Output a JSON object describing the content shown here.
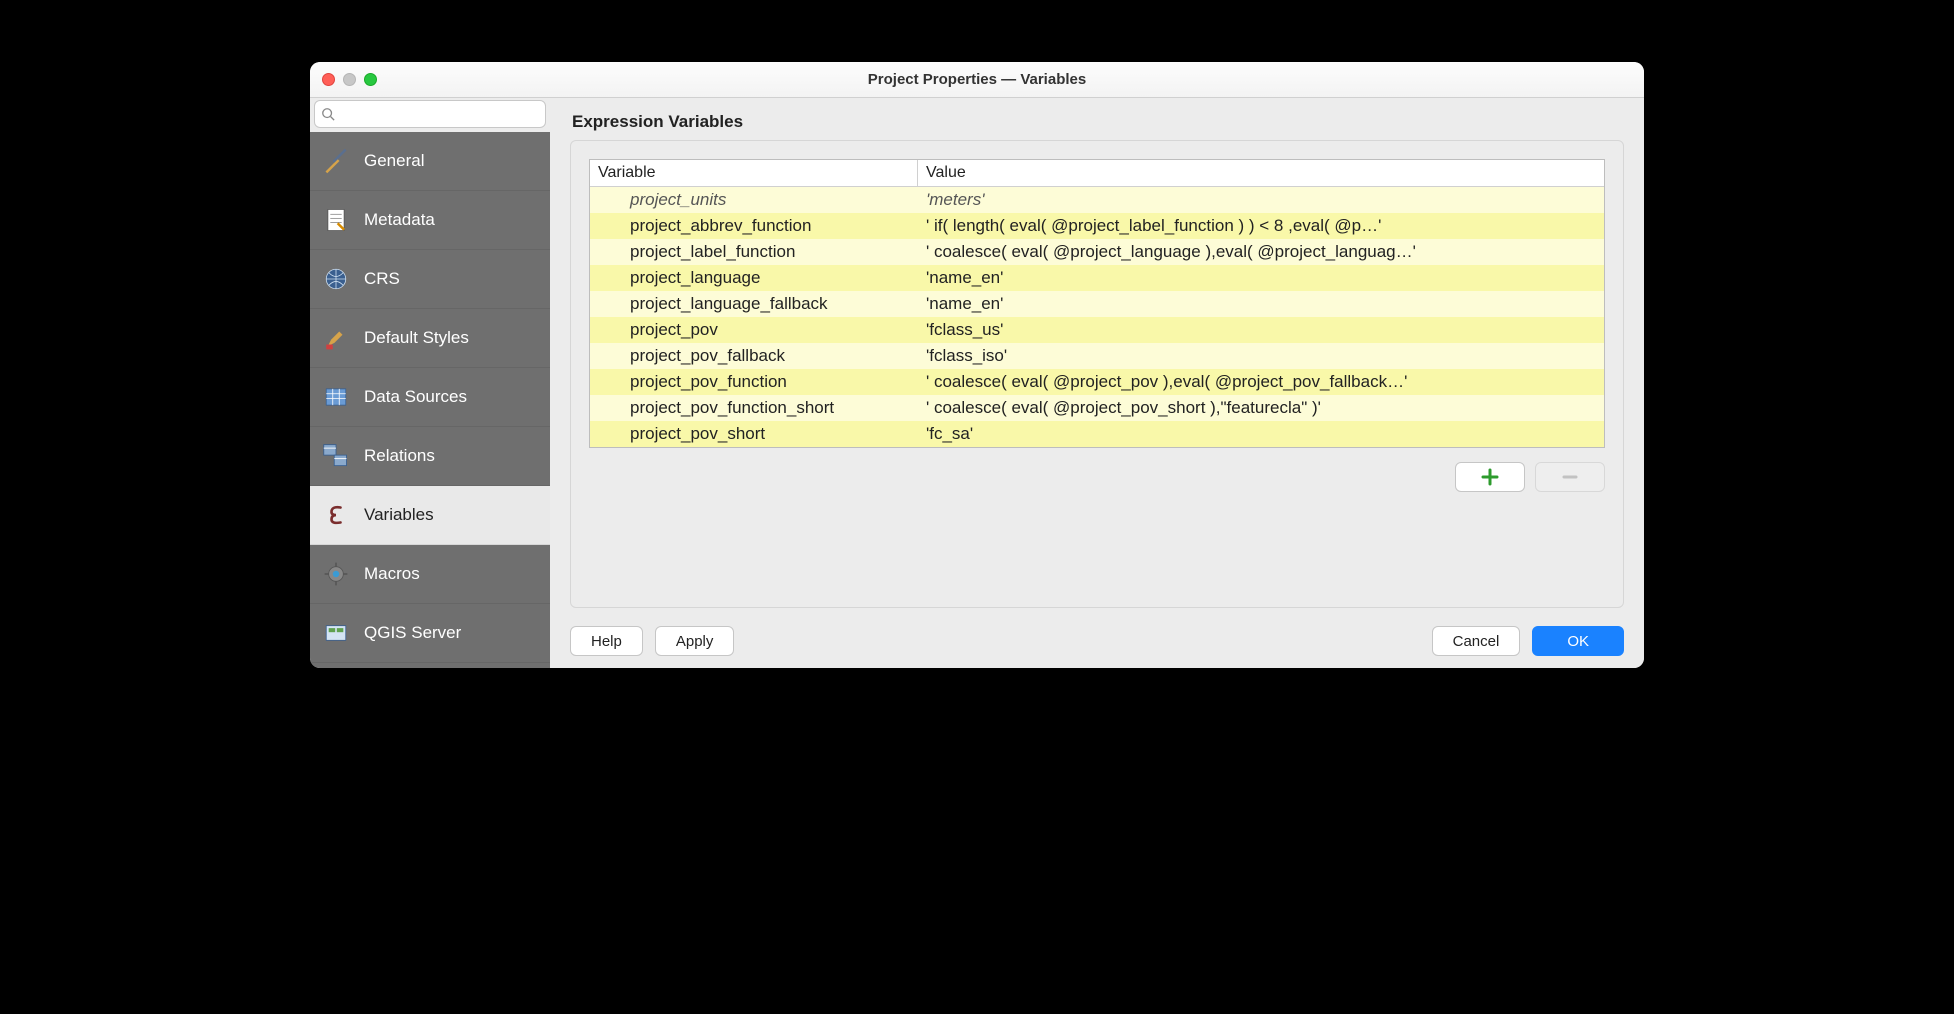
{
  "window": {
    "title": "Project Properties — Variables"
  },
  "search": {
    "placeholder": ""
  },
  "sidebar": {
    "items": [
      {
        "label": "General"
      },
      {
        "label": "Metadata"
      },
      {
        "label": "CRS"
      },
      {
        "label": "Default Styles"
      },
      {
        "label": "Data Sources"
      },
      {
        "label": "Relations"
      },
      {
        "label": "Variables"
      },
      {
        "label": "Macros"
      },
      {
        "label": "QGIS Server"
      }
    ],
    "selected_index": 6
  },
  "section_title": "Expression Variables",
  "table": {
    "headers": {
      "variable": "Variable",
      "value": "Value"
    },
    "rows": [
      {
        "variable": "project_units",
        "value": "'meters'",
        "readonly": true
      },
      {
        "variable": "project_abbrev_function",
        "value": "' if( length( eval( @project_label_function ) ) < 8 ,eval( @p…'"
      },
      {
        "variable": "project_label_function",
        "value": "' coalesce( eval( @project_language ),eval( @project_languag…'"
      },
      {
        "variable": "project_language",
        "value": "'name_en'"
      },
      {
        "variable": "project_language_fallback",
        "value": "'name_en'"
      },
      {
        "variable": "project_pov",
        "value": "'fclass_us'"
      },
      {
        "variable": "project_pov_fallback",
        "value": "'fclass_iso'"
      },
      {
        "variable": "project_pov_function",
        "value": "' coalesce( eval( @project_pov ),eval( @project_pov_fallback…'"
      },
      {
        "variable": "project_pov_function_short",
        "value": "' coalesce( eval( @project_pov_short ),\"featurecla\" )'"
      },
      {
        "variable": "project_pov_short",
        "value": "'fc_sa'"
      }
    ]
  },
  "buttons": {
    "help": "Help",
    "apply": "Apply",
    "cancel": "Cancel",
    "ok": "OK"
  },
  "colors": {
    "row_odd": "#fdfcd7",
    "row_even": "#f9f8a9",
    "primary": "#1a82ff",
    "sidebar_bg": "#6f6f6f"
  }
}
